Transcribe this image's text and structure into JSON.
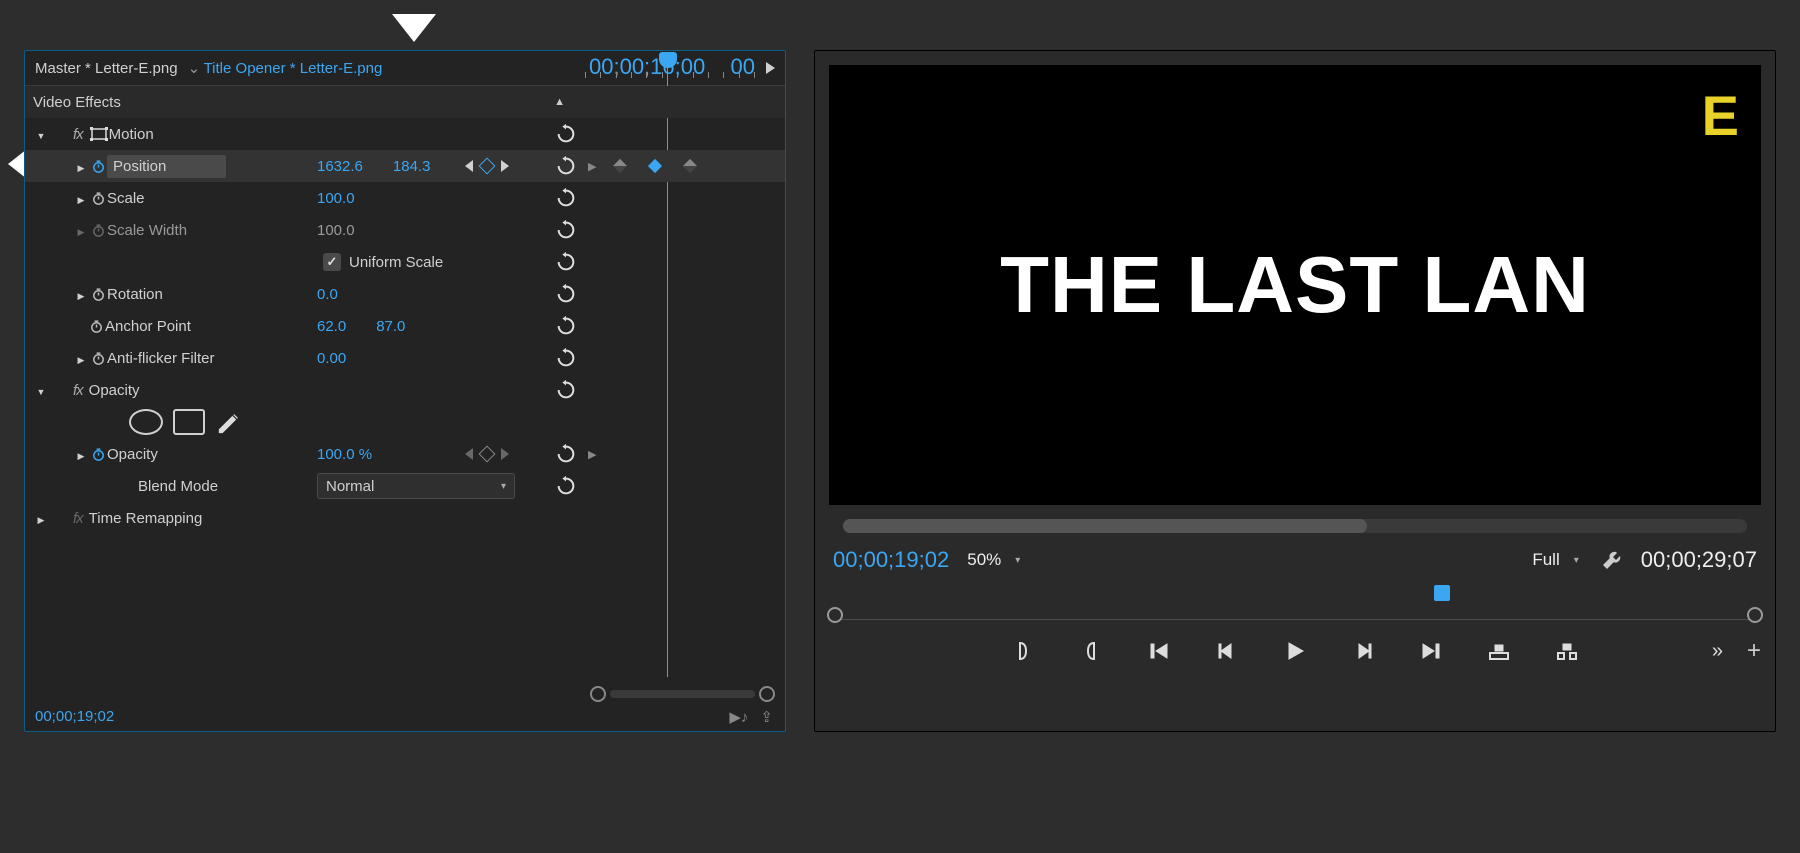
{
  "ec": {
    "master_tab": "Master * Letter-E.png",
    "active_tab": "Title Opener * Letter-E.png",
    "timecode": "00;00;19;02",
    "kf_header_time": "00;00;16;00",
    "kf_header_end": "00",
    "clip_name": "Letter-E.png",
    "section_effects": "Video Effects",
    "motion": {
      "label": "Motion",
      "position_label": "Position",
      "position_x": "1632.6",
      "position_y": "184.3",
      "scale_label": "Scale",
      "scale_value": "100.0",
      "scale_width_label": "Scale Width",
      "scale_width_value": "100.0",
      "uniform_label": "Uniform Scale",
      "rotation_label": "Rotation",
      "rotation_value": "0.0",
      "anchor_label": "Anchor Point",
      "anchor_x": "62.0",
      "anchor_y": "87.0",
      "antiflicker_label": "Anti-flicker Filter",
      "antiflicker_value": "0.00"
    },
    "opacity": {
      "label": "Opacity",
      "opacity_label": "Opacity",
      "opacity_value": "100.0 %",
      "blend_label": "Blend Mode",
      "blend_value": "Normal"
    },
    "time_remap_label": "Time Remapping"
  },
  "monitor": {
    "title_text": "THE LAST LAN",
    "letter": "E",
    "current_tc": "00;00;19;02",
    "duration_tc": "00;00;29;07",
    "zoom": "50%",
    "resolution": "Full"
  }
}
